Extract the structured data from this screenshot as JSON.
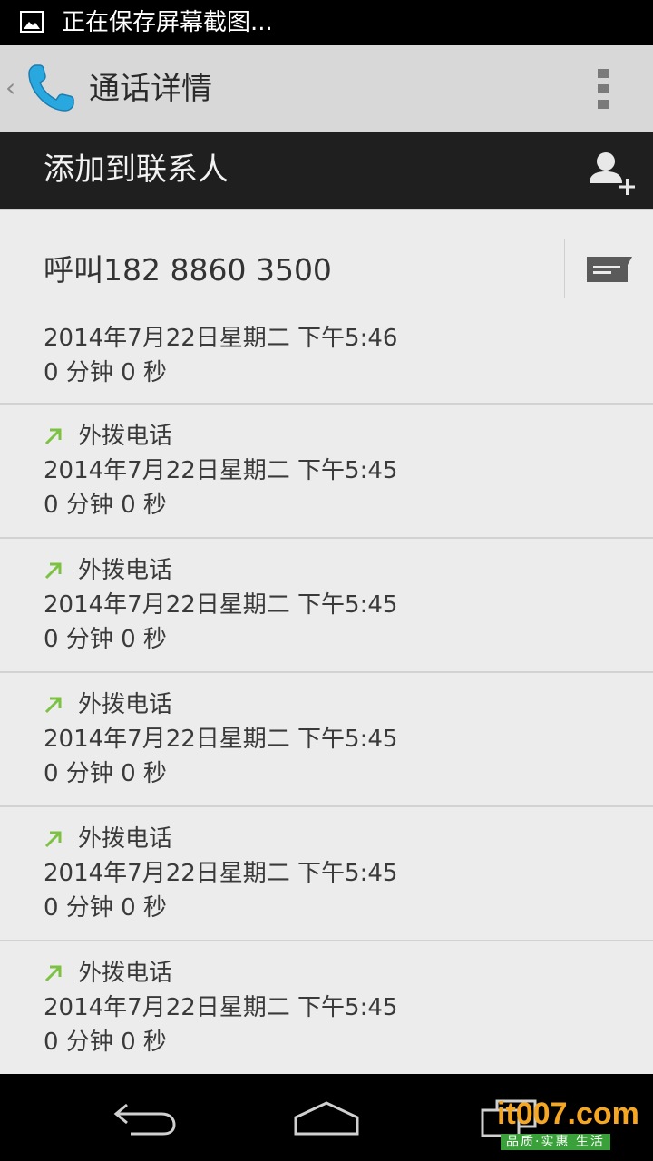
{
  "status_bar": {
    "notification_icon": "image-icon",
    "notification_text": "正在保存屏幕截图..."
  },
  "action_bar": {
    "title": "通话详情",
    "app_icon": "phone-handset-icon",
    "overflow_icon": "overflow-menu-icon"
  },
  "contact_bar": {
    "label": "添加到联系人",
    "icon": "add-contact-icon"
  },
  "call_action": {
    "label": "呼叫182 8860 3500",
    "sms_icon": "message-icon"
  },
  "summary": {
    "datetime": "2014年7月22日星期二 下午5:46",
    "duration": "0 分钟 0 秒"
  },
  "entries": [
    {
      "type": "外拨电话",
      "datetime": "2014年7月22日星期二 下午5:45",
      "duration": "0 分钟 0 秒"
    },
    {
      "type": "外拨电话",
      "datetime": "2014年7月22日星期二 下午5:45",
      "duration": "0 分钟 0 秒"
    },
    {
      "type": "外拨电话",
      "datetime": "2014年7月22日星期二 下午5:45",
      "duration": "0 分钟 0 秒"
    },
    {
      "type": "外拨电话",
      "datetime": "2014年7月22日星期二 下午5:45",
      "duration": "0 分钟 0 秒"
    },
    {
      "type": "外拨电话",
      "datetime": "2014年7月22日星期二 下午5:45",
      "duration": "0 分钟 0 秒"
    }
  ],
  "nav_bar": {
    "back_icon": "back-icon",
    "home_icon": "home-icon",
    "recent_icon": "recent-apps-icon"
  },
  "watermark": {
    "logo": "it007.com",
    "tagline": "品质·实惠 生活"
  },
  "colors": {
    "outgoing_arrow": "#7cc242",
    "phone_icon": "#29a8e0",
    "watermark_orange": "#f5a623",
    "watermark_green": "#3aa13a"
  }
}
